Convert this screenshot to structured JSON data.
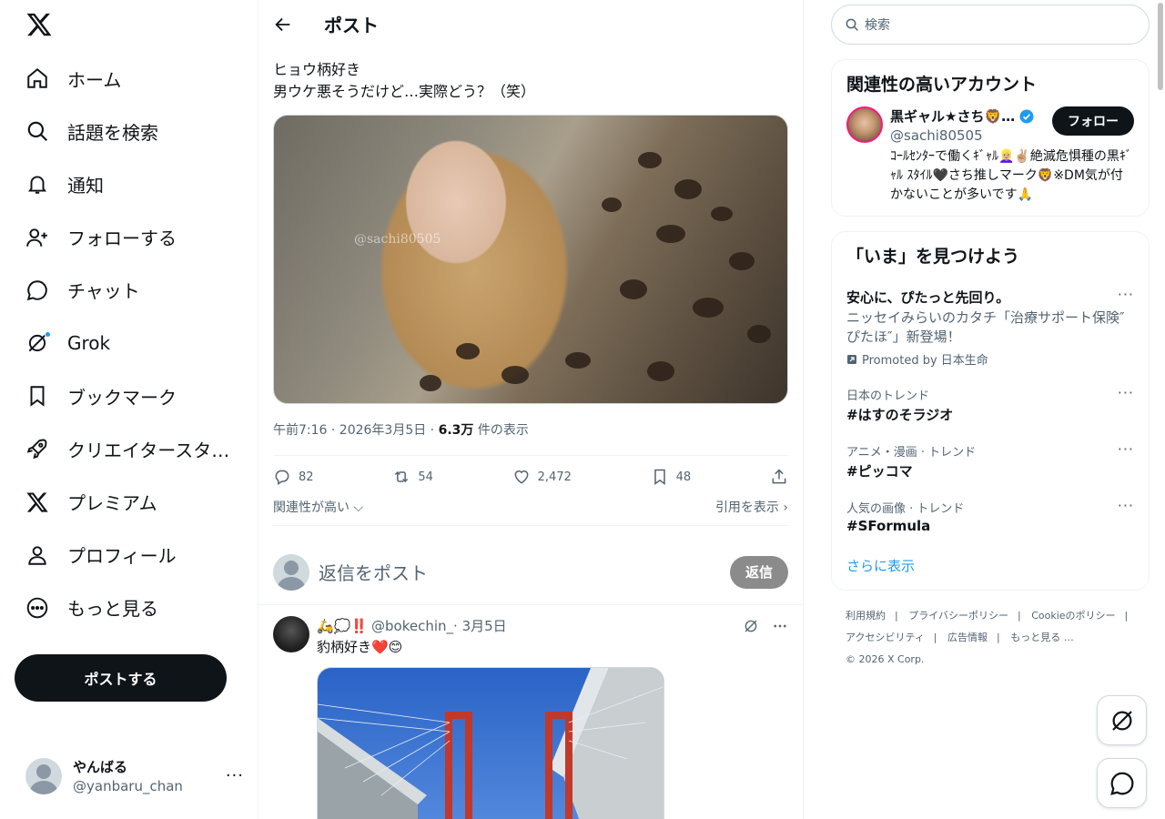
{
  "sidebar": {
    "logo": "x-logo-icon",
    "items": [
      {
        "label": "ホーム",
        "icon": "home-icon"
      },
      {
        "label": "話題を検索",
        "icon": "search-icon"
      },
      {
        "label": "通知",
        "icon": "bell-icon"
      },
      {
        "label": "フォローする",
        "icon": "person-add-icon"
      },
      {
        "label": "チャット",
        "icon": "chat-icon"
      },
      {
        "label": "Grok",
        "icon": "grok-icon"
      },
      {
        "label": "ブックマーク",
        "icon": "bookmark-icon"
      },
      {
        "label": "クリエイタースタ…",
        "icon": "rocket-icon"
      },
      {
        "label": "プレミアム",
        "icon": "x-premium-icon"
      },
      {
        "label": "プロフィール",
        "icon": "person-icon"
      },
      {
        "label": "もっと見る",
        "icon": "more-circle-icon"
      }
    ],
    "post_button": "ポストする",
    "account": {
      "name": "やんばる",
      "handle": "@yanbaru_chan",
      "more": "···"
    }
  },
  "header": {
    "title": "ポスト"
  },
  "tweet": {
    "text_line1": "ヒョウ柄好き",
    "text_line2": "男ウケ悪そうだけど…実際どう？（笑）",
    "watermark": "@sachi80505",
    "time": "午前7:16 · 2026年3月5日 · ",
    "views": "6.3万",
    "views_suffix": " 件の表示",
    "replies": "82",
    "reposts": "54",
    "likes": "2,472",
    "bookmarks": "48",
    "sort_label": "関連性が高い",
    "quotes_label": "引用を表示",
    "reply_placeholder": "返信をポスト",
    "reply_button": "返信"
  },
  "reply": {
    "name": "🛵💭‼️",
    "handle": "@bokechin_",
    "date": " · 3月5日",
    "text": "豹柄好き❤️😊"
  },
  "right": {
    "search_placeholder": "検索",
    "related_title": "関連性の高いアカウント",
    "account": {
      "name": "黒ギャル★さち🦁…",
      "handle": "@sachi80505",
      "follow": "フォロー",
      "bio": "ｺｰﾙｾﾝﾀｰで働くｷﾞｬﾙ👱🏼‍♀️✌🏼絶滅危惧種の黒ｷﾞｬﾙ ｽﾀｲﾙ🖤さち推しマーク🦁※DM気が付かないことが多いです🙏"
    },
    "explore_title": "「いま」を見つけよう",
    "promo": {
      "title": "安心に、ぴたっと先回り。",
      "body": "ニッセイみらいのカタチ「治療サポート保険″ぴたほ″」新登場！",
      "by": "Promoted by 日本生命"
    },
    "trends": [
      {
        "context": "日本のトレンド",
        "name": "#はすのそラジオ"
      },
      {
        "context": "アニメ・漫画 · トレンド",
        "name": "#ピッコマ"
      },
      {
        "context": "人気の画像 · トレンド",
        "name": "#SFormula"
      }
    ],
    "show_more": "さらに表示",
    "footer": {
      "terms": "利用規約",
      "privacy": "プライバシーポリシー",
      "cookie": "Cookieのポリシー",
      "accessibility": "アクセシビリティ",
      "ads": "広告情報",
      "more": "もっと見る …",
      "copyright": "© 2026 X Corp."
    }
  },
  "colors": {
    "accent": "#1d9bf0",
    "text": "#0f1419",
    "muted": "#536471",
    "border": "#eff3f4"
  }
}
